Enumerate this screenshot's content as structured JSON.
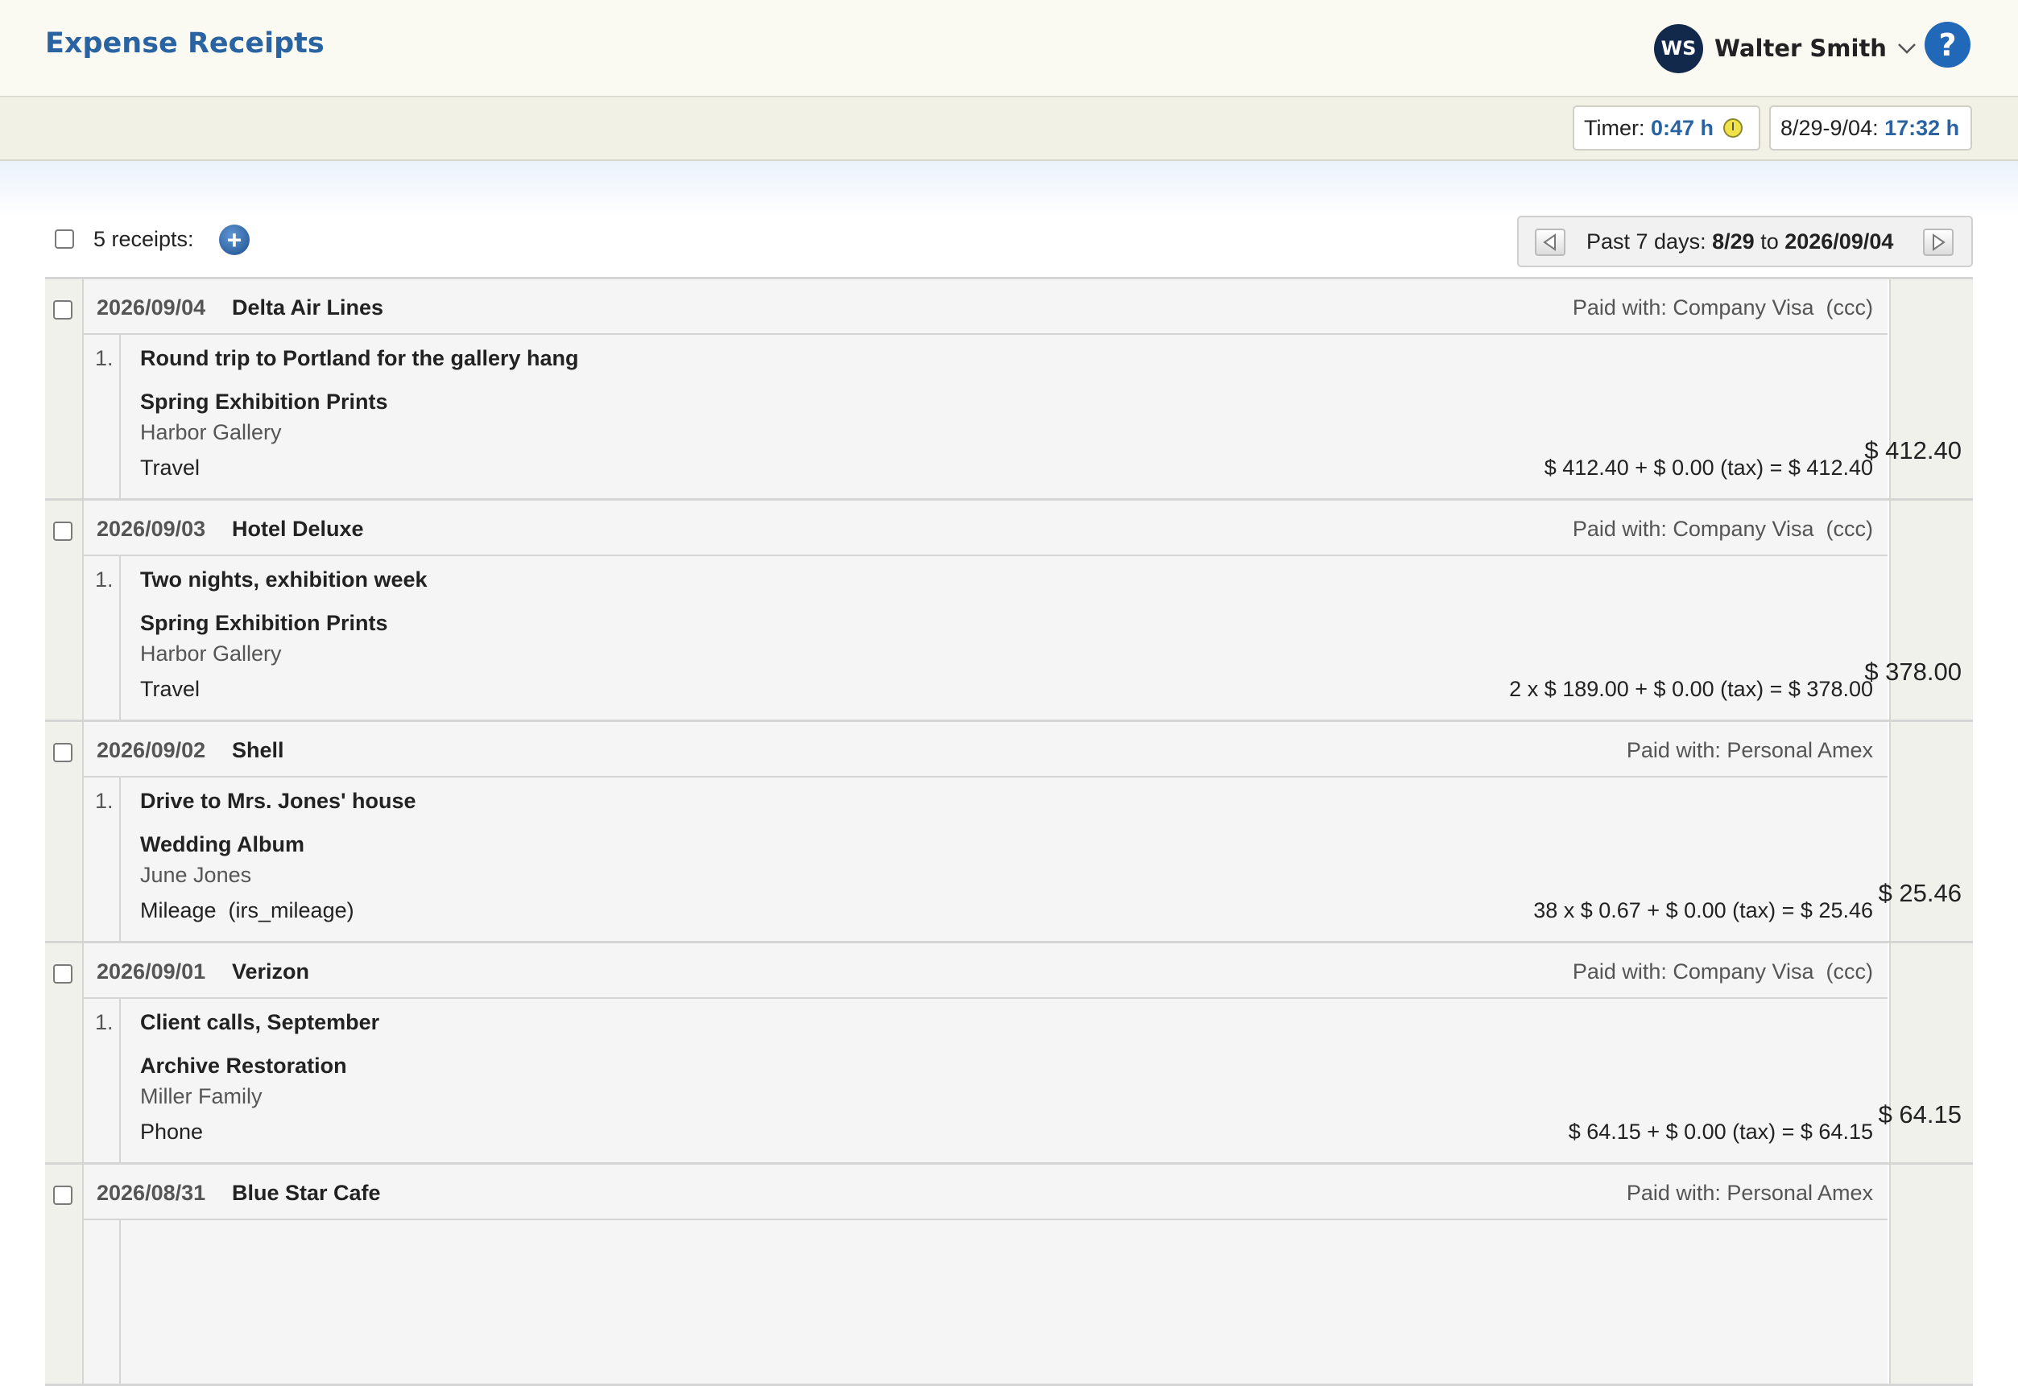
{
  "app": {
    "title": "Expense Receipts"
  },
  "user": {
    "initials": "WS",
    "name": "Walter Smith"
  },
  "help": {
    "label": "?"
  },
  "timer": {
    "label": "Timer:",
    "value": "0:47 h"
  },
  "week": {
    "label": "8/29-9/04:",
    "value": "17:32 h"
  },
  "toolbar": {
    "count_label": "5 receipts:",
    "add_symbol": "+"
  },
  "range": {
    "prefix": "Past 7 days:",
    "start": "8/29",
    "to": "to",
    "end": "2026/09/04"
  },
  "receipts": [
    {
      "date": "2026/09/04",
      "vendor": "Delta Air Lines",
      "paid_with": "Paid with: Company Visa  (ccc)",
      "item_number": "1.",
      "description": "Round trip to Portland for the gallery hang",
      "project": "Spring Exhibition Prints",
      "client": "Harbor Gallery",
      "category": "Travel",
      "calc": "$ 412.40 + $ 0.00 (tax) = $ 412.40",
      "total": "$ 412.40"
    },
    {
      "date": "2026/09/03",
      "vendor": "Hotel Deluxe",
      "paid_with": "Paid with: Company Visa  (ccc)",
      "item_number": "1.",
      "description": "Two nights, exhibition week",
      "project": "Spring Exhibition Prints",
      "client": "Harbor Gallery",
      "category": "Travel",
      "calc": "2 x $ 189.00 + $ 0.00 (tax) = $ 378.00",
      "total": "$ 378.00"
    },
    {
      "date": "2026/09/02",
      "vendor": "Shell",
      "paid_with": "Paid with: Personal Amex",
      "item_number": "1.",
      "description": "Drive to Mrs. Jones' house",
      "project": "Wedding Album",
      "client": "June Jones",
      "category": "Mileage  (irs_mileage)",
      "calc": "38 x $ 0.67 + $ 0.00 (tax) = $ 25.46",
      "total": "$ 25.46"
    },
    {
      "date": "2026/09/01",
      "vendor": "Verizon",
      "paid_with": "Paid with: Company Visa  (ccc)",
      "item_number": "1.",
      "description": "Client calls, September",
      "project": "Archive Restoration",
      "client": "Miller Family",
      "category": "Phone",
      "calc": "$ 64.15 + $ 0.00 (tax) = $ 64.15",
      "total": "$ 64.15"
    },
    {
      "date": "2026/08/31",
      "vendor": "Blue Star Cafe",
      "paid_with": "Paid with: Personal Amex"
    }
  ],
  "colors": {
    "accent": "#2a63a2",
    "avatar_bg": "#13294b",
    "help_bg": "#2268b8",
    "header_bg": "#fbfaf2",
    "clock_icon": "#f2e24a"
  }
}
